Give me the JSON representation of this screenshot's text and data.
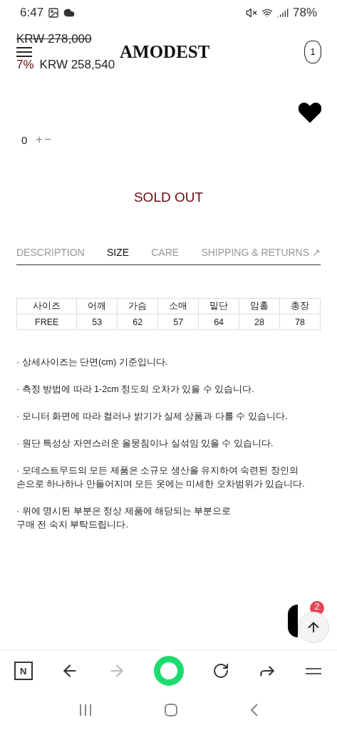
{
  "status_bar": {
    "time": "6:47",
    "battery": "78%"
  },
  "header": {
    "old_price": "KRW 278,000",
    "discount": "7%",
    "price": "KRW 258,540",
    "logo": "AMODEST",
    "cart_count": "1"
  },
  "wishlist": {
    "selected": true
  },
  "quantity": {
    "value": "0",
    "plus": "+",
    "minus": "−"
  },
  "sold_out": "SOLD OUT",
  "tabs": [
    {
      "label": "DESCRIPTION",
      "selected": false
    },
    {
      "label": "SIZE",
      "selected": true
    },
    {
      "label": "CARE",
      "selected": false
    },
    {
      "label": "SHIPPING & RETURNS ↗",
      "selected": false
    }
  ],
  "size_table": {
    "columns": [
      "사이즈",
      "어깨",
      "가슴",
      "소매",
      "밑단",
      "암홀",
      "총장"
    ],
    "rows": [
      [
        "FREE",
        "53",
        "62",
        "57",
        "64",
        "28",
        "78"
      ]
    ]
  },
  "notes": [
    "· 상세사이즈는 단면(cm) 기준입니다.",
    "· 측정 방법에 따라 1-2cm 정도의 오차가 있을 수 있습니다.",
    "· 모니터 화면에 따라 컬러나 밝기가 실제 상품과 다를 수 있습니다.",
    "· 원단 특성상 자연스러운 올뭉침이나 실섞임 있을 수 있습니다.",
    "· 모데스트무드의 모든 제품은 소규모 생산을 유지하여 숙련된 장인의\n  손으로 하나하나 만들어지며 모든 옷에는 미세한 오차범위가 있습니다.",
    "· 위에 명시된 부분은 정상 제품에 해당되는 부분으로\n  구매 전 숙지 부탁드립니다."
  ],
  "chat": {
    "badge": "2"
  },
  "browser_bar": {
    "home_label": "N",
    "forward_disabled": true
  }
}
